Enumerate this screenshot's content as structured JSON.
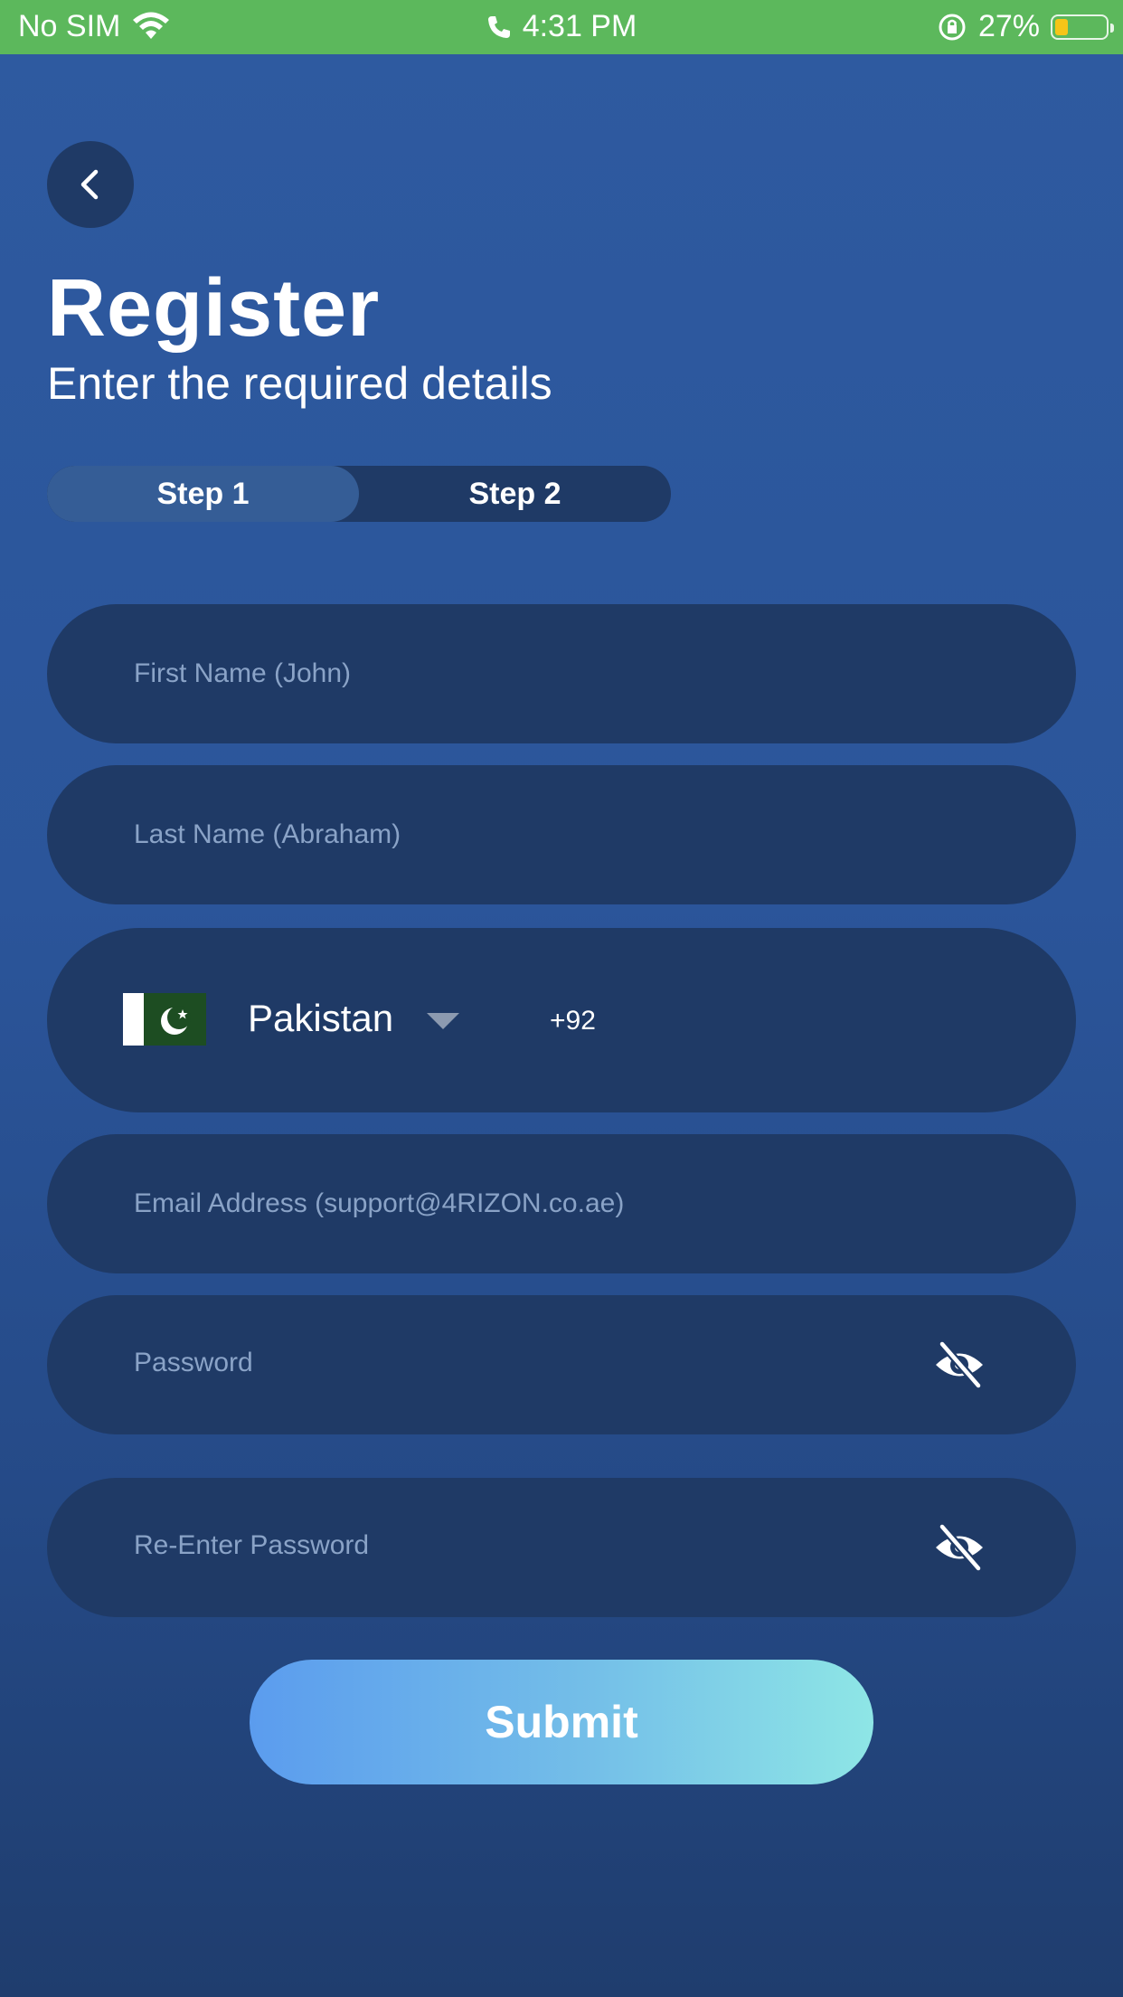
{
  "status_bar": {
    "carrier": "No SIM",
    "time": "4:31 PM",
    "battery": "27%",
    "battery_level": 0.27,
    "bar_color": "#5cb85c"
  },
  "header": {
    "title": "Register",
    "subtitle": "Enter the required details"
  },
  "steps": [
    {
      "label": "Step 1",
      "active": true
    },
    {
      "label": "Step 2",
      "active": false
    }
  ],
  "form": {
    "first_name_placeholder": "First Name (John)",
    "last_name_placeholder": "Last Name (Abraham)",
    "phone": {
      "country": "Pakistan",
      "dial_code": "+92"
    },
    "email_placeholder": "Email Address (support@4RIZON.co.ae)",
    "password_placeholder": "Password",
    "reenter_password_placeholder": "Re-Enter Password"
  },
  "submit_label": "Submit",
  "colors": {
    "background_top": "#2e5aa0",
    "field_bg": "#1f3a66",
    "placeholder": "#8aa3c7",
    "submit_gradient_start": "#5b9cee",
    "submit_gradient_end": "#8ee6e6"
  }
}
